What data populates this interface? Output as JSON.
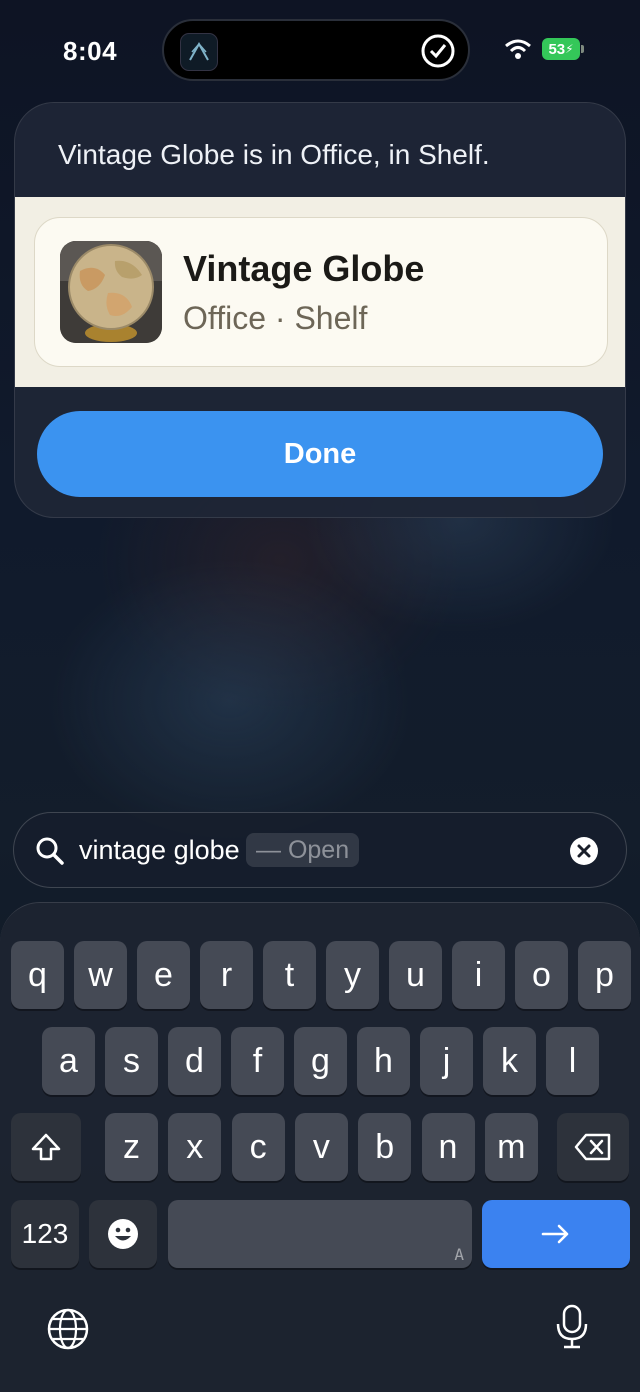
{
  "status_bar": {
    "time": "8:04",
    "battery": "53"
  },
  "card": {
    "message": "Vintage Globe is in Office, in Shelf.",
    "result": {
      "title": "Vintage Globe",
      "subtitle": "Office · Shelf"
    },
    "done_label": "Done"
  },
  "search": {
    "query": "vintage globe",
    "hint": "— Open"
  },
  "keyboard": {
    "row1": [
      "q",
      "w",
      "e",
      "r",
      "t",
      "y",
      "u",
      "i",
      "o",
      "p"
    ],
    "row2": [
      "a",
      "s",
      "d",
      "f",
      "g",
      "h",
      "j",
      "k",
      "l"
    ],
    "row3": [
      "z",
      "x",
      "c",
      "v",
      "b",
      "n",
      "m"
    ],
    "numbers_label": "123",
    "space_label": "A"
  },
  "colors": {
    "accent": "#3b93f0",
    "battery": "#34c759"
  }
}
